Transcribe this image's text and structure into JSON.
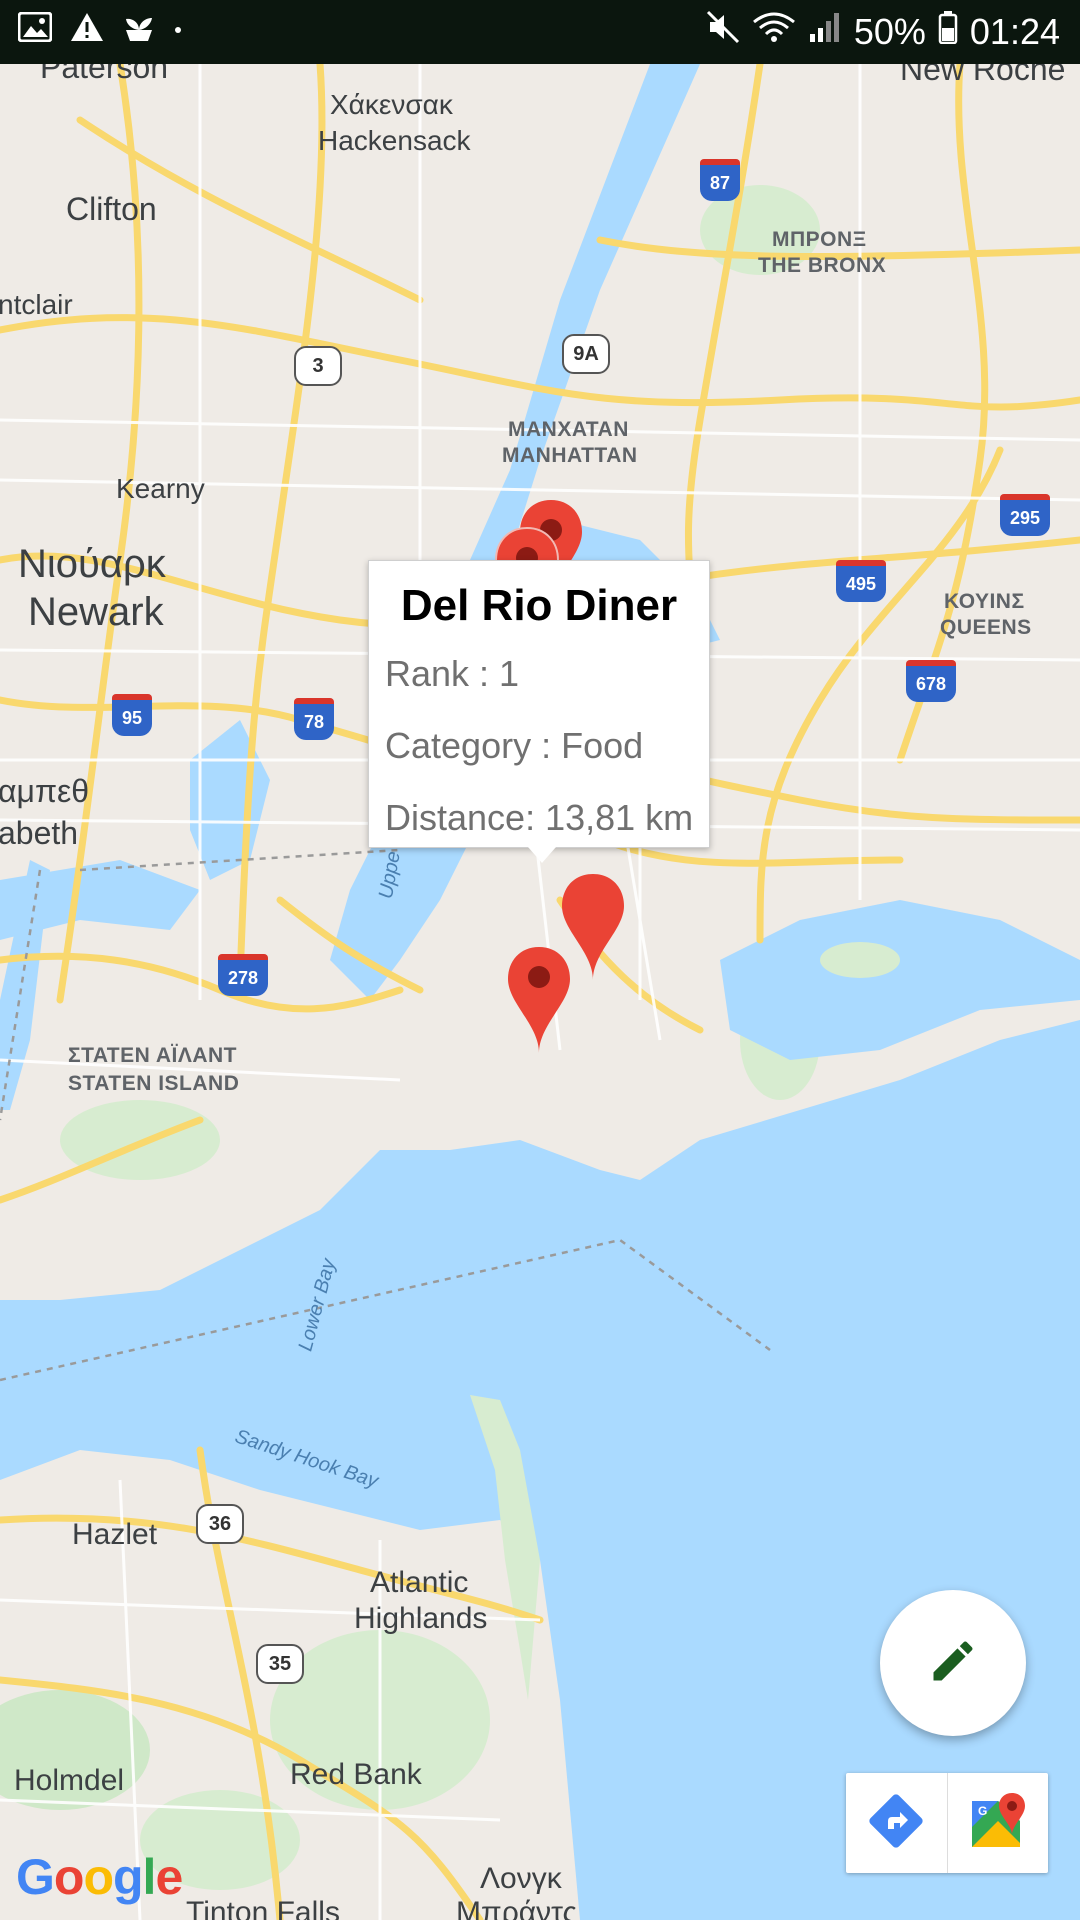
{
  "status_bar": {
    "battery": "50%",
    "time": "01:24"
  },
  "map": {
    "labels": {
      "paterson": "Paterson",
      "new_rochelle": "New Roche",
      "hackensack_gr": "Χάκενσακ",
      "hackensack": "Hackensack",
      "clifton": "Clifton",
      "montclair": "ntclair",
      "bronx_gr": "ΜΠΡΟΝΞ",
      "bronx": "THE BRONX",
      "kearny": "Kearny",
      "manhattan_gr": "ΜΑΝΧΑΤΑΝ",
      "manhattan": "MANHATTAN",
      "newark_gr": "Νιούαρκ",
      "newark": "Newark",
      "queens_gr": "ΚΟΥΙΝΣ",
      "queens": "QUEENS",
      "elizabeth_gr": "αμπεθ",
      "elizabeth": "abeth",
      "upper_bay": "Uppe",
      "staten_island_gr": "ΣΤΑΤΕΝ ΑΪΛΑΝΤ",
      "staten_island": "STATEN ISLAND",
      "lower_bay": "Lower Bay",
      "sandy_hook_bay": "Sandy Hook Bay",
      "hazlet": "Hazlet",
      "atlantic_highlands_1": "Atlantic",
      "atlantic_highlands_2": "Highlands",
      "holmdel": "Holmdel",
      "red_bank": "Red Bank",
      "long_branch_gr": "Λονγκ",
      "tinton_falls": "Tinton Falls",
      "long_branch_gr2": "Μπράντς"
    },
    "route_shields": {
      "r3": "3",
      "r9a": "9A",
      "r36": "36",
      "r35": "35",
      "i87": "87",
      "i295": "295",
      "i495": "495",
      "i678": "678",
      "i95": "95",
      "i78": "78",
      "i278": "278"
    }
  },
  "info_window": {
    "title": "Del Rio Diner",
    "rank": "Rank : 1",
    "category": "Category : Food",
    "distance": "Distance: 13,81 km"
  },
  "google_logo": {
    "letters": [
      "G",
      "o",
      "o",
      "g",
      "l",
      "e"
    ],
    "colors": [
      "#4285F4",
      "#EA4335",
      "#FBBC05",
      "#4285F4",
      "#34A853",
      "#EA4335"
    ]
  },
  "colors": {
    "marker": "#ea4335",
    "marker_dot": "#8c1b14",
    "fab_icon": "#1b5e20",
    "directions": "#4285f4"
  }
}
